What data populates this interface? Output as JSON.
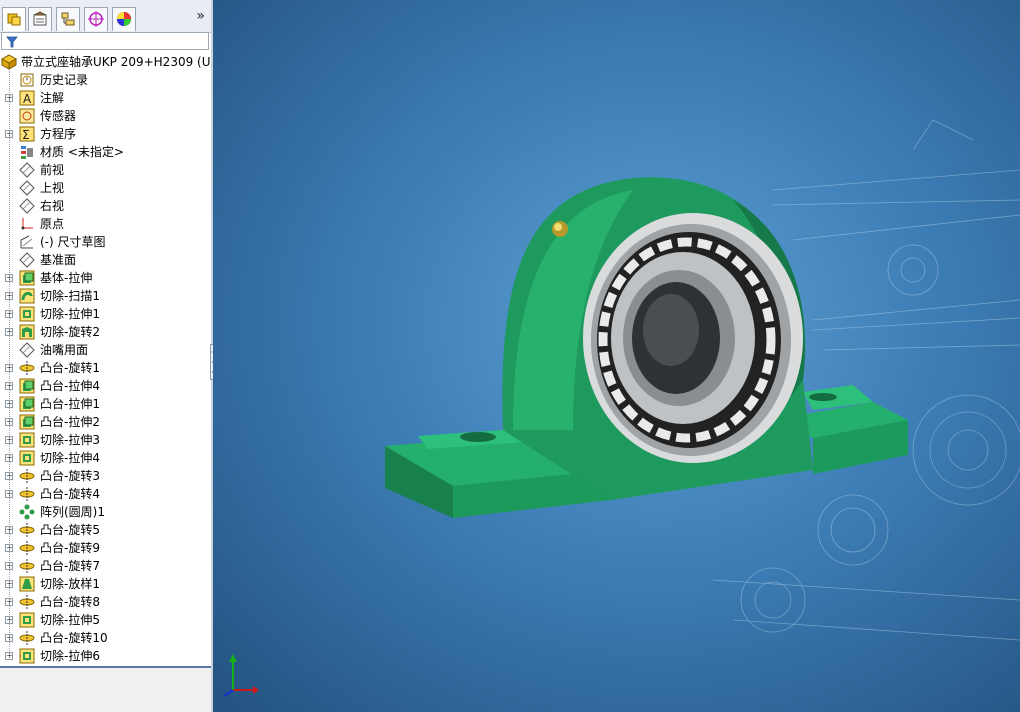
{
  "window": {
    "more_glyph": "»"
  },
  "tabs": [
    {
      "name": "feature-manager-tab",
      "icon": "feature-tree-icon",
      "active": true
    },
    {
      "name": "property-manager-tab",
      "icon": "property-manager-icon",
      "active": false
    },
    {
      "name": "configuration-manager-tab",
      "icon": "configuration-manager-icon",
      "active": false
    },
    {
      "name": "dimxpert-tab",
      "icon": "dimxpert-icon",
      "active": false
    },
    {
      "name": "display-manager-tab",
      "icon": "display-manager-icon",
      "active": false
    }
  ],
  "filter": {
    "icon": "filter-icon"
  },
  "tree": {
    "root": {
      "label": "带立式座轴承UKP 209+H2309  (U",
      "icon": "part-icon"
    },
    "items": [
      {
        "label": "历史记录",
        "icon": "history-icon",
        "expand": false
      },
      {
        "label": "注解",
        "icon": "annotations-icon",
        "expand": true
      },
      {
        "label": "传感器",
        "icon": "sensor-icon",
        "expand": false
      },
      {
        "label": "方程序",
        "icon": "equations-icon",
        "expand": true
      },
      {
        "label": "材质 <未指定>",
        "icon": "material-icon",
        "expand": false
      },
      {
        "label": "前视",
        "icon": "plane-icon",
        "expand": false
      },
      {
        "label": "上视",
        "icon": "plane-icon",
        "expand": false
      },
      {
        "label": "右视",
        "icon": "plane-icon",
        "expand": false
      },
      {
        "label": "原点",
        "icon": "origin-icon",
        "expand": false
      },
      {
        "label": "(-) 尺寸草图",
        "icon": "sketch-icon",
        "expand": false
      },
      {
        "label": "基准面",
        "icon": "plane-icon",
        "expand": false
      },
      {
        "label": "基体-拉伸",
        "icon": "boss-extrude-icon",
        "expand": true
      },
      {
        "label": "切除-扫描1",
        "icon": "cut-sweep-icon",
        "expand": true
      },
      {
        "label": "切除-拉伸1",
        "icon": "cut-extrude-icon",
        "expand": true
      },
      {
        "label": "切除-旋转2",
        "icon": "cut-revolve-icon",
        "expand": true
      },
      {
        "label": "油嘴用面",
        "icon": "plane-icon",
        "expand": false
      },
      {
        "label": "凸台-旋转1",
        "icon": "boss-revolve-icon",
        "expand": true
      },
      {
        "label": "凸台-拉伸4",
        "icon": "boss-extrude-icon",
        "expand": true
      },
      {
        "label": "凸台-拉伸1",
        "icon": "boss-extrude-icon",
        "expand": true
      },
      {
        "label": "凸台-拉伸2",
        "icon": "boss-extrude-icon",
        "expand": true
      },
      {
        "label": "切除-拉伸3",
        "icon": "cut-extrude-icon",
        "expand": true
      },
      {
        "label": "切除-拉伸4",
        "icon": "cut-extrude-icon",
        "expand": true
      },
      {
        "label": "凸台-旋转3",
        "icon": "boss-revolve-icon",
        "expand": true
      },
      {
        "label": "凸台-旋转4",
        "icon": "boss-revolve-icon",
        "expand": true
      },
      {
        "label": "阵列(圆周)1",
        "icon": "circular-pattern-icon",
        "expand": false
      },
      {
        "label": "凸台-旋转5",
        "icon": "boss-revolve-icon",
        "expand": true
      },
      {
        "label": "凸台-旋转9",
        "icon": "boss-revolve-icon",
        "expand": true
      },
      {
        "label": "凸台-旋转7",
        "icon": "boss-revolve-icon",
        "expand": true
      },
      {
        "label": "切除-放样1",
        "icon": "cut-loft-icon",
        "expand": true
      },
      {
        "label": "凸台-旋转8",
        "icon": "boss-revolve-icon",
        "expand": true
      },
      {
        "label": "切除-拉伸5",
        "icon": "cut-extrude-icon",
        "expand": true
      },
      {
        "label": "凸台-旋转10",
        "icon": "boss-revolve-icon",
        "expand": true
      },
      {
        "label": "切除-拉伸6",
        "icon": "cut-extrude-icon",
        "expand": true
      }
    ]
  },
  "viewport": {
    "model_color": "#1f9a5e",
    "triad_icon": "coordinate-triad-icon"
  }
}
